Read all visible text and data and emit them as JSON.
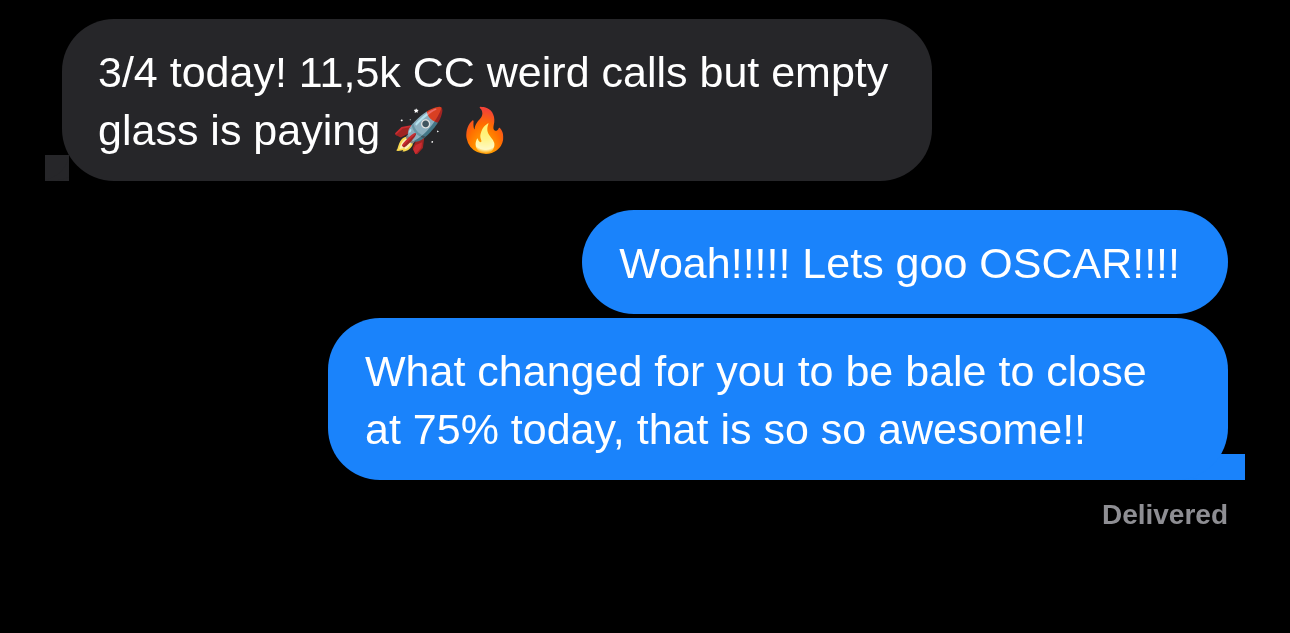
{
  "messages": [
    {
      "kind": "received",
      "text": "3/4 today! 11,5k CC weird calls but empty glass is paying 🚀 🔥",
      "tail": true
    },
    {
      "kind": "sent",
      "text": "Woah!!!!! Lets goo OSCAR!!!!",
      "tail": false
    },
    {
      "kind": "sent",
      "text": "What changed for you to be bale to close at 75% today, that is so so awesome!!",
      "tail": true
    }
  ],
  "status": "Delivered"
}
